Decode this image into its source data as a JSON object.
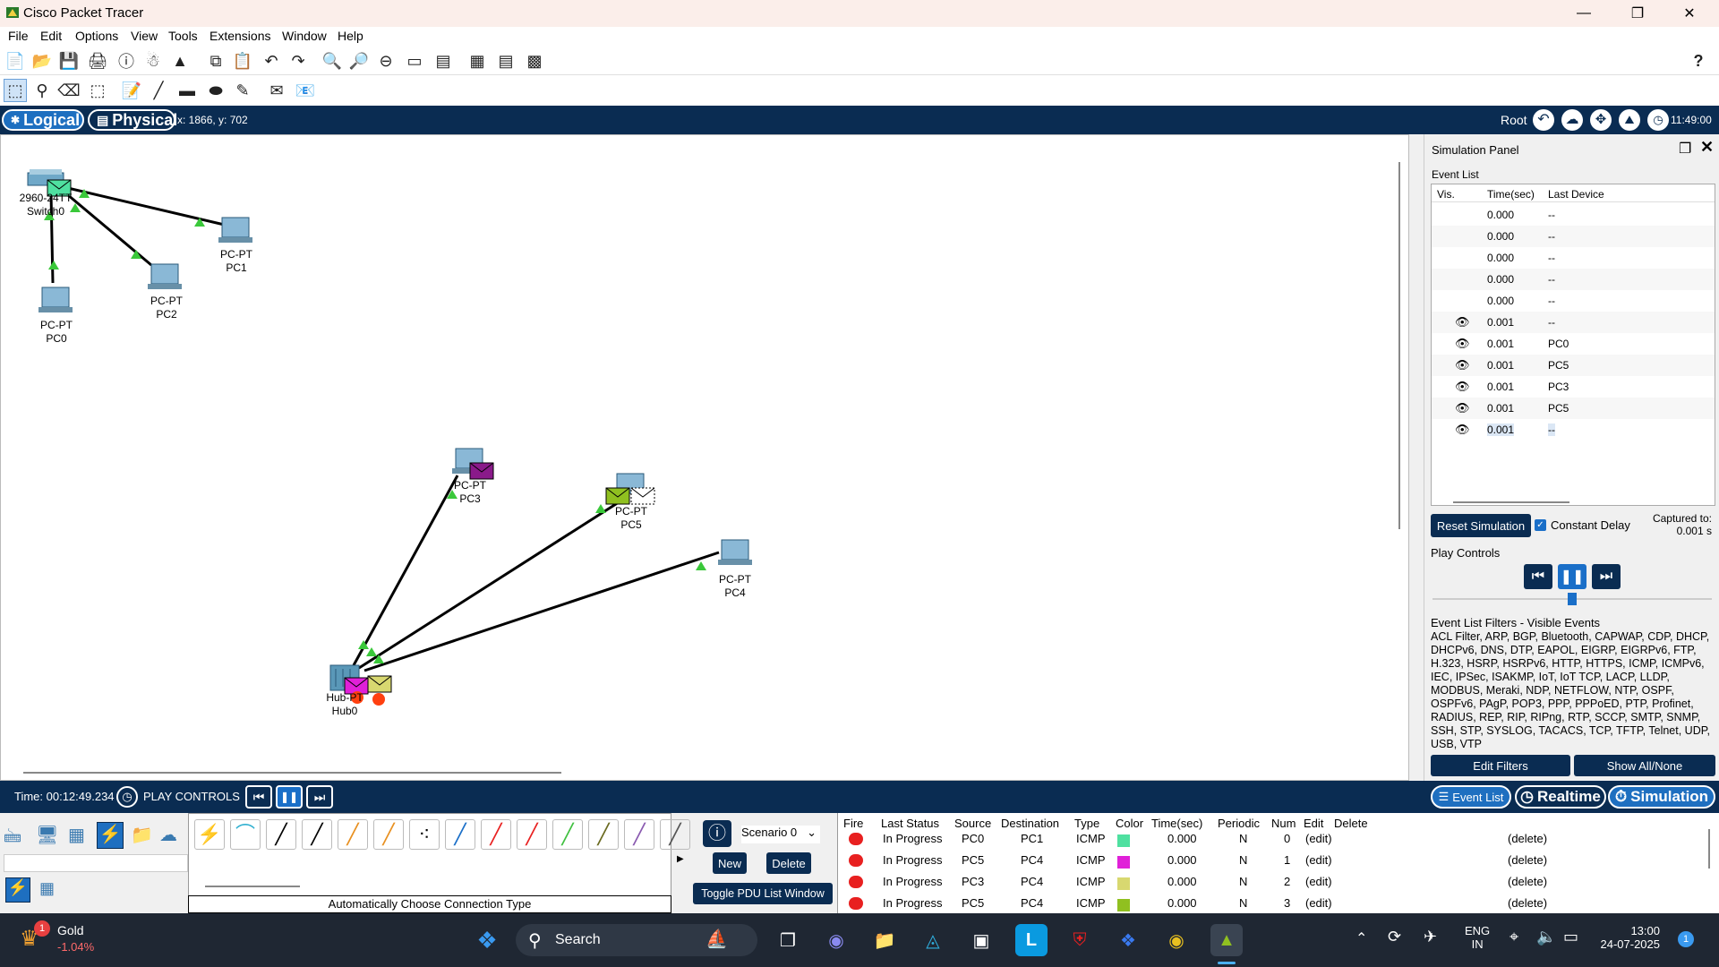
{
  "window": {
    "title": "Cisco Packet Tracer"
  },
  "menu": [
    "File",
    "Edit",
    "Options",
    "View",
    "Tools",
    "Extensions",
    "Window",
    "Help"
  ],
  "view_tabs": {
    "logical": "Logical",
    "physical": "Physical",
    "coords": "x: 1866, y: 702"
  },
  "topright": {
    "root": "Root",
    "clock": "11:49:00"
  },
  "devices": {
    "switch0": {
      "model": "2960-24TT",
      "name": "Switch0"
    },
    "pc0": {
      "model": "PC-PT",
      "name": "PC0"
    },
    "pc1": {
      "model": "PC-PT",
      "name": "PC1"
    },
    "pc2": {
      "model": "PC-PT",
      "name": "PC2"
    },
    "pc3": {
      "model": "PC-PT",
      "name": "PC3"
    },
    "pc4": {
      "model": "PC-PT",
      "name": "PC4"
    },
    "pc5": {
      "model": "PC-PT",
      "name": "PC5"
    },
    "hub0": {
      "model": "Hub-PT",
      "name": "Hub0"
    }
  },
  "sim_panel": {
    "title": "Simulation Panel",
    "event_list_label": "Event List",
    "columns": [
      "Vis.",
      "Time(sec)",
      "Last Device"
    ],
    "events": [
      {
        "vis": false,
        "time": "0.000",
        "device": "--"
      },
      {
        "vis": false,
        "time": "0.000",
        "device": "--"
      },
      {
        "vis": false,
        "time": "0.000",
        "device": "--"
      },
      {
        "vis": false,
        "time": "0.000",
        "device": "--"
      },
      {
        "vis": false,
        "time": "0.000",
        "device": "--"
      },
      {
        "vis": true,
        "time": "0.001",
        "device": "--"
      },
      {
        "vis": true,
        "time": "0.001",
        "device": "PC0"
      },
      {
        "vis": true,
        "time": "0.001",
        "device": "PC5"
      },
      {
        "vis": true,
        "time": "0.001",
        "device": "PC3"
      },
      {
        "vis": true,
        "time": "0.001",
        "device": "PC5"
      },
      {
        "vis": true,
        "time": "0.001",
        "device": "--"
      }
    ],
    "reset_label": "Reset Simulation",
    "constant_delay": "Constant Delay",
    "captured_label": "Captured to:",
    "captured_value": "0.001 s",
    "play_controls": "Play Controls",
    "filters_title": "Event List Filters - Visible Events",
    "filters_text": "ACL Filter, ARP, BGP, Bluetooth, CAPWAP, CDP, DHCP, DHCPv6, DNS, DTP, EAPOL, EIGRP, EIGRPv6, FTP, H.323, HSRP, HSRPv6, HTTP, HTTPS, ICMP, ICMPv6, IEC, IPSec, ISAKMP, IoT, IoT TCP, LACP, LLDP, MODBUS, Meraki, NDP, NETFLOW, NTP, OSPF, OSPFv6, PAgP, POP3, PPP, PPPoED, PTP, Profinet, RADIUS, REP, RIP, RIPng, RTP, SCCP, SMTP, SNMP, SSH, STP, SYSLOG, TACACS, TCP, TFTP, Telnet, UDP, USB, VTP",
    "edit_filters": "Edit Filters",
    "show_all": "Show All/None"
  },
  "timebar": {
    "time": "Time: 00:12:49.234",
    "play_controls": "PLAY CONTROLS",
    "event_list_btn": "Event List",
    "realtime": "Realtime",
    "simulation": "Simulation"
  },
  "bottom": {
    "connection_type": "Automatically Choose Connection Type",
    "scenario": "Scenario 0",
    "new": "New",
    "delete": "Delete",
    "toggle_pdu": "Toggle PDU List Window",
    "pdu_columns": [
      "Fire",
      "Last Status",
      "Source",
      "Destination",
      "Type",
      "Color",
      "Time(sec)",
      "Periodic",
      "Num",
      "Edit",
      "Delete"
    ],
    "pdu_rows": [
      {
        "status": "In Progress",
        "source": "PC0",
        "dest": "PC1",
        "type": "ICMP",
        "color": "#4fe0a0",
        "time": "0.000",
        "periodic": "N",
        "num": "0",
        "edit": "(edit)",
        "delete": "(delete)"
      },
      {
        "status": "In Progress",
        "source": "PC5",
        "dest": "PC4",
        "type": "ICMP",
        "color": "#e020d8",
        "time": "0.000",
        "periodic": "N",
        "num": "1",
        "edit": "(edit)",
        "delete": "(delete)"
      },
      {
        "status": "In Progress",
        "source": "PC3",
        "dest": "PC4",
        "type": "ICMP",
        "color": "#d8d870",
        "time": "0.000",
        "periodic": "N",
        "num": "2",
        "edit": "(edit)",
        "delete": "(delete)"
      },
      {
        "status": "In Progress",
        "source": "PC5",
        "dest": "PC4",
        "type": "ICMP",
        "color": "#90c020",
        "time": "0.000",
        "periodic": "N",
        "num": "3",
        "edit": "(edit)",
        "delete": "(delete)"
      }
    ]
  },
  "taskbar": {
    "stock_name": "Gold",
    "stock_change": "-1.04%",
    "stock_badge": "1",
    "search": "Search",
    "lang1": "ENG",
    "lang2": "IN",
    "time": "13:00",
    "date": "24-07-2025",
    "notif": "1"
  }
}
